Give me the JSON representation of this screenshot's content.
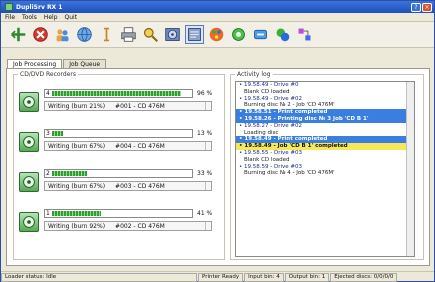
{
  "window": {
    "title": "DupliSrv RX 1"
  },
  "menu": [
    "File",
    "Tools",
    "Help",
    "Quit"
  ],
  "toolbar": {
    "tools": [
      {
        "icon": "move-icon",
        "label": "Move"
      },
      {
        "icon": "stop-icon",
        "label": "Stop"
      },
      {
        "icon": "users-icon",
        "label": "Users"
      },
      {
        "icon": "globe-icon",
        "label": "Network"
      },
      {
        "icon": "cursor-icon",
        "label": "Text"
      },
      {
        "icon": "printer-icon",
        "label": "Print"
      },
      {
        "icon": "search-icon",
        "label": "Search"
      },
      {
        "icon": "disc-icon",
        "label": "Disc"
      },
      {
        "icon": "settings-icon",
        "label": "Settings"
      },
      {
        "icon": "palette-icon",
        "label": "Palette"
      },
      {
        "icon": "tools-icon",
        "label": "Tools"
      },
      {
        "icon": "refresh-icon",
        "label": "Refresh"
      },
      {
        "icon": "gear-icon",
        "label": "Preferences"
      },
      {
        "icon": "network-icon",
        "label": "Connect"
      }
    ]
  },
  "tabs": [
    "Job Processing",
    "Job Queue"
  ],
  "recorders_group": {
    "label": "CD/DVD Recorders"
  },
  "recorders": [
    {
      "num": "4",
      "fill": 0.92,
      "percent": "96 %",
      "status": "Writing (burn 21%)",
      "job": "#001 - CD 476M"
    },
    {
      "num": "3",
      "fill": 0.08,
      "percent": "13 %",
      "status": "Writing (burn 67%)",
      "job": "#004 - CD 476M"
    },
    {
      "num": "2",
      "fill": 0.25,
      "percent": "33 %",
      "status": "Writing (burn 67%)",
      "job": "#003 - CD 476M"
    },
    {
      "num": "1",
      "fill": 0.35,
      "percent": "41 %",
      "status": "Writing (burn 92%)",
      "job": "#002 - CD 476M"
    }
  ],
  "activity": {
    "label": "Activity log",
    "lines": [
      {
        "text": "• 19.58.49 - Drive #0",
        "style": "head"
      },
      {
        "text": "Blank CD loaded",
        "style": "detail"
      },
      {
        "text": "• 19.58.49 - Drive #02",
        "style": "head"
      },
      {
        "text": "Burning disc № 2 - Job 'CD 476M'",
        "style": "detail"
      },
      {
        "text": "• 19.58.51 - Print completed",
        "style": "hl"
      },
      {
        "text": "• 19.58.26 - Printing disc № 3 Job 'CD B 1'",
        "style": "hl"
      },
      {
        "text": "• 19.58.27 - Drive #02",
        "style": "head"
      },
      {
        "text": "Loading disc",
        "style": "detail"
      },
      {
        "text": "• 19.58.49 - Print completed",
        "style": "hl"
      },
      {
        "text": "• 19.58.49 - Job 'CD B 1' completed",
        "style": "hl-yellow"
      },
      {
        "text": "• 19.58.55 - Drive #03",
        "style": "head"
      },
      {
        "text": "Blank CD loaded",
        "style": "detail"
      },
      {
        "text": "• 19.58.59 - Drive #03",
        "style": "head"
      },
      {
        "text": "Burning disc № 4 - Job 'CD 476M'",
        "style": "detail"
      }
    ]
  },
  "statusbar": {
    "loader": "Loader status: Idle",
    "printer": "Printer Ready",
    "input_bin": "Input bin: 4",
    "output_bin": "Output bin: 1",
    "ejected": "Ejected discs: 0/0/0/0"
  }
}
